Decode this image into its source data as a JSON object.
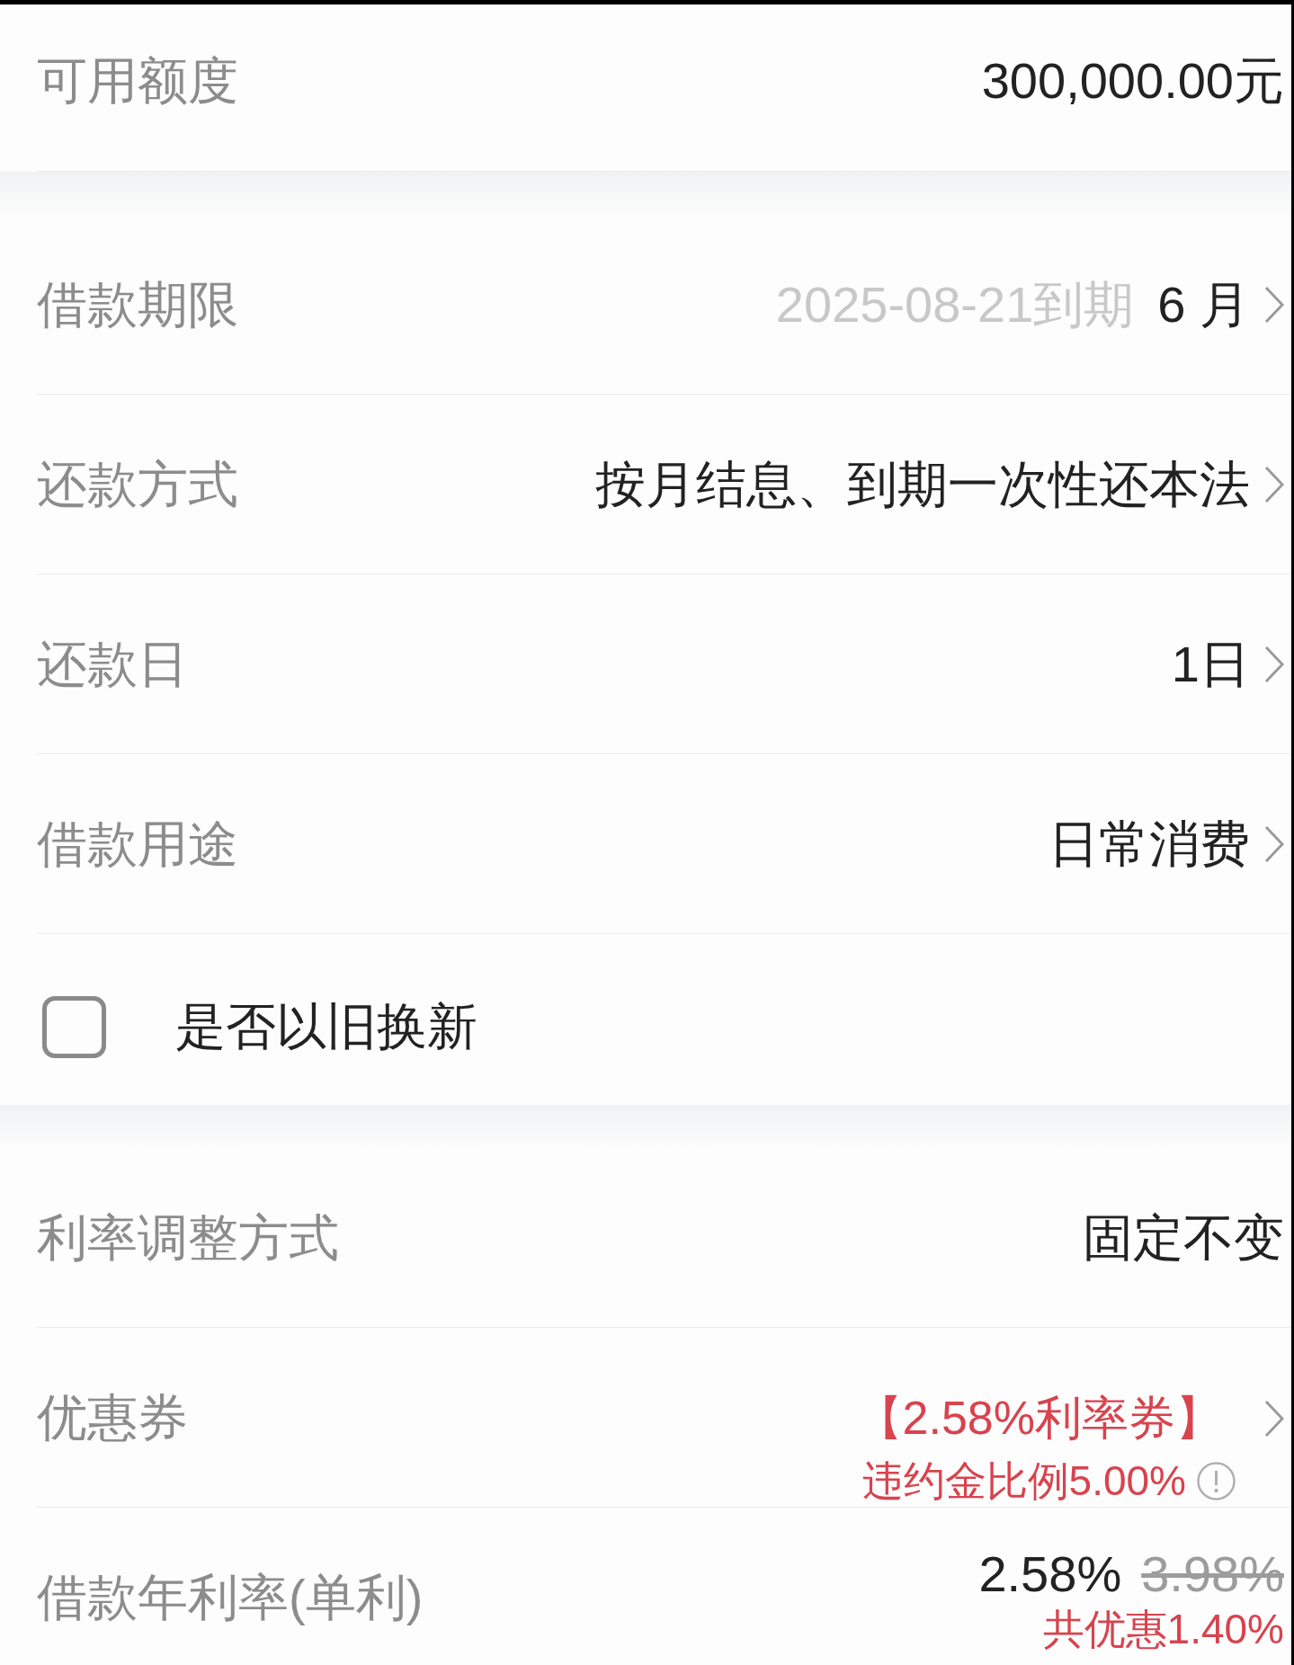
{
  "sections": [
    {
      "rows": [
        {
          "kind": "value",
          "label": "可用额度",
          "value": "300,000.00元",
          "chevron": false
        }
      ]
    },
    {
      "rows": [
        {
          "kind": "value",
          "label": "借款期限",
          "due_date": "2025-08-21到期",
          "value": "6 月",
          "chevron": true
        },
        {
          "kind": "value",
          "label": "还款方式",
          "value": "按月结息、到期一次性还本法",
          "chevron": true
        },
        {
          "kind": "value",
          "label": "还款日",
          "value": "1日",
          "chevron": true
        },
        {
          "kind": "value",
          "label": "借款用途",
          "value": "日常消费",
          "chevron": true
        },
        {
          "kind": "checkbox",
          "label": "是否以旧换新",
          "checked": false
        }
      ]
    },
    {
      "rows": [
        {
          "kind": "value",
          "label": "利率调整方式",
          "value": "固定不变",
          "chevron": false
        },
        {
          "kind": "coupon",
          "label": "优惠券",
          "value": "【2.58%利率券】",
          "note": "违约金比例5.00%",
          "chevron": true
        },
        {
          "kind": "rate",
          "label": "借款年利率(单利)",
          "value": "2.58%",
          "original_rate": "3.98%",
          "note": "共优惠1.40%"
        }
      ]
    }
  ]
}
